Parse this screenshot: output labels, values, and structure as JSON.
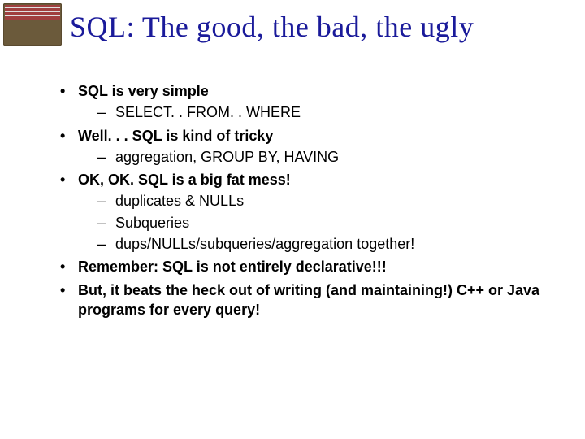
{
  "title": "SQL: The good, the bad, the ugly",
  "bullets": [
    {
      "text": "SQL is very simple",
      "sub": [
        "SELECT. . FROM. . WHERE"
      ]
    },
    {
      "text": "Well. . . SQL is kind of tricky",
      "sub": [
        "aggregation, GROUP BY, HAVING"
      ]
    },
    {
      "text": "OK, OK.  SQL is a big fat mess!",
      "sub": [
        "duplicates & NULLs",
        "Subqueries",
        "dups/NULLs/subqueries/aggregation together!"
      ]
    },
    {
      "text": "Remember: SQL is not entirely declarative!!!",
      "sub": []
    },
    {
      "text": "But, it beats the heck out of writing (and maintaining!) C++ or Java programs for every query!",
      "sub": []
    }
  ]
}
